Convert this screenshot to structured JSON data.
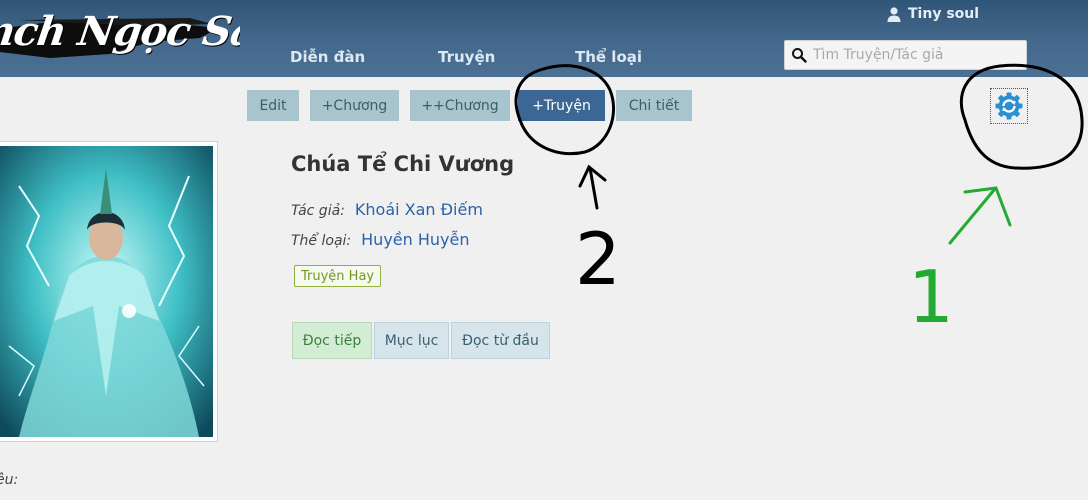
{
  "header": {
    "logo_text": "nch Ngọc Sách",
    "nav": [
      "Diễn đàn",
      "Truyện",
      "Thể loại"
    ],
    "user_name": "Tiny soul",
    "search_placeholder": "Tìm Truyện/Tác giả"
  },
  "toolbar": {
    "buttons": [
      "Edit",
      "+Chương",
      "++Chương",
      "+Truyện",
      "Chi tiết"
    ],
    "active": "+Truyện",
    "settings_icon": "gear-refresh-icon"
  },
  "book": {
    "title": "Chúa Tể Chi Vương",
    "author_label": "Tác giả:",
    "author": "Khoái Xan Điếm",
    "genre_label": "Thể loại:",
    "genre": "Huyền Huyễn",
    "badge": "Truyện Hay",
    "actions": [
      "Đọc tiếp",
      "Mục lục",
      "Đọc từ đầu"
    ],
    "description_label": "ệu:"
  },
  "annotations": {
    "label_2": "2",
    "label_1": "1",
    "color_2": "#000000",
    "color_1": "#22aa33"
  },
  "colors": {
    "header_top": "#2f5577",
    "active_button": "#3c6795",
    "toolbar_button": "#a8c4cc",
    "link": "#2a64a8"
  }
}
